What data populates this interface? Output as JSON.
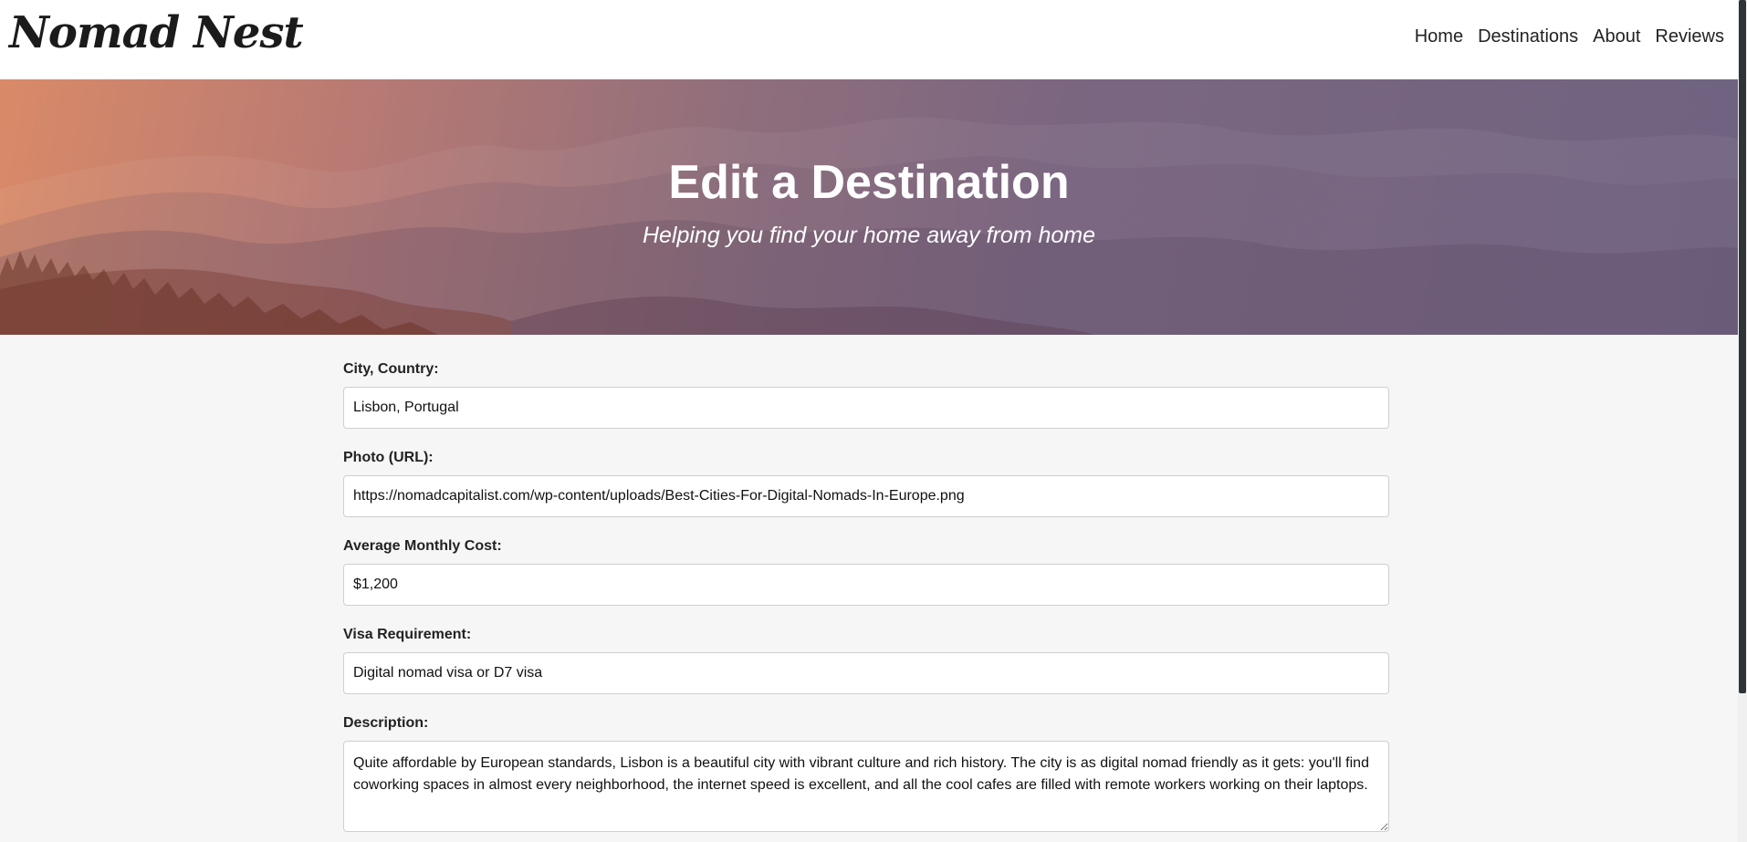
{
  "navbar": {
    "brand": "Nomad Nest",
    "links": [
      {
        "label": "Home"
      },
      {
        "label": "Destinations"
      },
      {
        "label": "About"
      },
      {
        "label": "Reviews"
      }
    ]
  },
  "hero": {
    "title": "Edit a Destination",
    "subtitle": "Helping you find your home away from home"
  },
  "form": {
    "city": {
      "label": "City, Country:",
      "value": "Lisbon, Portugal"
    },
    "photo": {
      "label": "Photo (URL):",
      "value": "https://nomadcapitalist.com/wp-content/uploads/Best-Cities-For-Digital-Nomads-In-Europe.png"
    },
    "cost": {
      "label": "Average Monthly Cost:",
      "value": "$1,200"
    },
    "visa": {
      "label": "Visa Requirement:",
      "value": "Digital nomad visa or D7 visa"
    },
    "description": {
      "label": "Description:",
      "value": "Quite affordable by European standards, Lisbon is a beautiful city with vibrant culture and rich history. The city is as digital nomad friendly as it gets: you'll find coworking spaces in almost every neighborhood, the internet speed is excellent, and all the cool cafes are filled with remote workers working on their laptops."
    }
  },
  "colors": {
    "page_background": "#f6f6f6",
    "navbar_background": "#ffffff",
    "hero_warm": "#d98a68",
    "hero_cool": "#6f6381",
    "text": "#222222"
  }
}
